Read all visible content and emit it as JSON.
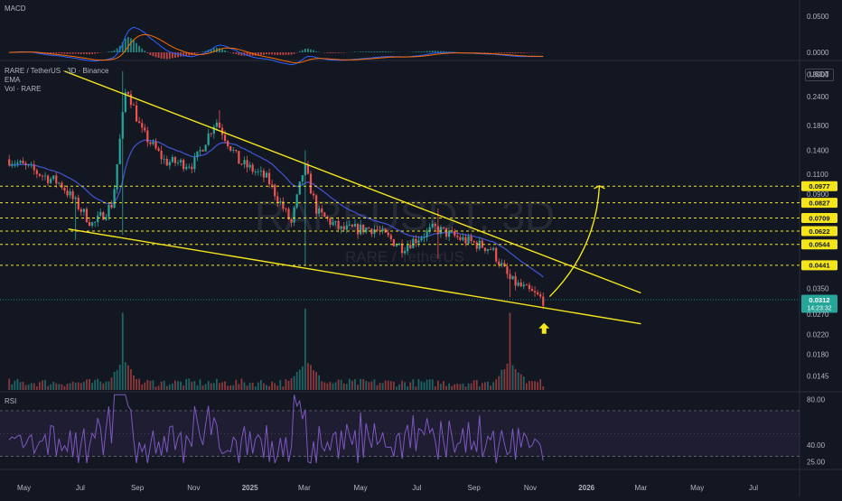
{
  "header": {
    "macd_label": "MACD",
    "symbol_line": "RARE / TetherUS · 3D · Binance",
    "ema_label": "EMA",
    "vol_label": "Vol · RARE",
    "rsi_label": "RSI",
    "currency": "USDT"
  },
  "watermark": {
    "main": "RAREUSDT, 3D",
    "sub": "RARE / TetherUS"
  },
  "current_price": {
    "value": "0.0312",
    "countdown": "14:23:32"
  },
  "colors": {
    "background": "#131722",
    "up": "#26a69a",
    "down": "#ef5350",
    "trendline": "#f5e61b",
    "ema": "#3f51c9",
    "rsi": "#7e57c2",
    "price_badge": "#26a69a"
  },
  "chart_data": [
    {
      "type": "candlestick",
      "scale": "log",
      "x_ticks": [
        "May",
        "Jul",
        "Sep",
        "Nov",
        "2025",
        "Mar",
        "May",
        "Jul",
        "Sep",
        "Nov",
        "2026",
        "Mar",
        "May",
        "Jul"
      ],
      "y_ticks": [
        "0.3000",
        "0.2400",
        "0.1800",
        "0.1400",
        "0.1100",
        "0.0900",
        "0.0350",
        "0.0270",
        "0.0220",
        "0.0180",
        "0.0145"
      ],
      "ylim": [
        0.0126,
        0.33
      ],
      "levels": [
        {
          "label": "0.0977",
          "value": 0.0977
        },
        {
          "label": "0.0827",
          "value": 0.0827
        },
        {
          "label": "0.0709",
          "value": 0.0709
        },
        {
          "label": "0.0622",
          "value": 0.0622
        },
        {
          "label": "0.0544",
          "value": 0.0544
        },
        {
          "label": "0.0441",
          "value": 0.0441
        }
      ],
      "falling_wedge": {
        "upper": [
          [
            "2024-06-14",
            0.31
          ],
          [
            "2026-03-01",
            0.0334
          ]
        ],
        "lower": [
          [
            "2024-06-18",
            0.0635
          ],
          [
            "2026-03-01",
            0.0245
          ]
        ]
      },
      "anchors": [
        {
          "date": "2024-04-15",
          "close": 0.128
        },
        {
          "date": "2024-06-10",
          "close": 0.1
        },
        {
          "date": "2024-07-15",
          "close": 0.066
        },
        {
          "date": "2024-08-05",
          "close": 0.082
        },
        {
          "date": "2024-08-20",
          "close": 0.27
        },
        {
          "date": "2024-09-05",
          "close": 0.17
        },
        {
          "date": "2024-10-01",
          "close": 0.125
        },
        {
          "date": "2024-11-01",
          "close": 0.122
        },
        {
          "date": "2024-11-25",
          "close": 0.19
        },
        {
          "date": "2024-12-20",
          "close": 0.125
        },
        {
          "date": "2025-01-20",
          "close": 0.105
        },
        {
          "date": "2025-02-15",
          "close": 0.067
        },
        {
          "date": "2025-03-01",
          "close": 0.12
        },
        {
          "date": "2025-03-15",
          "close": 0.075
        },
        {
          "date": "2025-04-10",
          "close": 0.063
        },
        {
          "date": "2025-05-15",
          "close": 0.064
        },
        {
          "date": "2025-06-15",
          "close": 0.053
        },
        {
          "date": "2025-07-20",
          "close": 0.064
        },
        {
          "date": "2025-08-15",
          "close": 0.058
        },
        {
          "date": "2025-09-20",
          "close": 0.052
        },
        {
          "date": "2025-10-10",
          "close": 0.038
        },
        {
          "date": "2025-10-30",
          "close": 0.034
        },
        {
          "date": "2025-11-15",
          "close": 0.0312
        }
      ],
      "volume_spikes": [
        {
          "date": "2024-08-17",
          "rel": 0.95
        },
        {
          "date": "2025-03-03",
          "rel": 1.0
        },
        {
          "date": "2025-10-10",
          "rel": 0.95
        }
      ]
    },
    {
      "type": "line",
      "name": "RSI",
      "y_ticks": [
        "80.00",
        "40.00",
        "25.00"
      ],
      "ylim": [
        20,
        85
      ],
      "bands": [
        30,
        70
      ]
    },
    {
      "type": "bar",
      "name": "MACD",
      "y_ticks": [
        "0.0500",
        "0.0000"
      ],
      "ylim": [
        -0.01,
        0.07
      ]
    }
  ]
}
